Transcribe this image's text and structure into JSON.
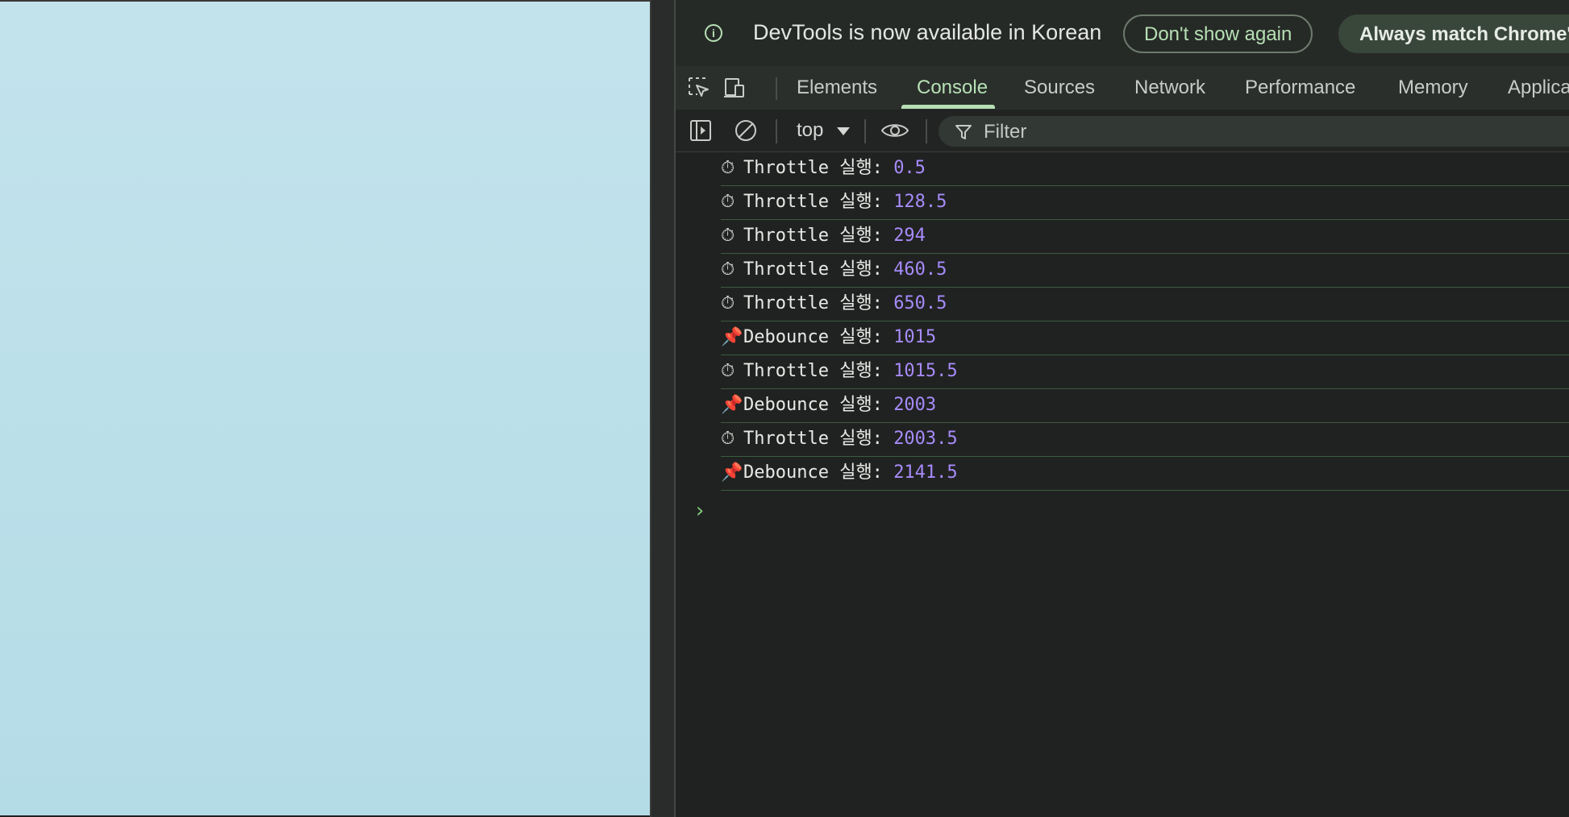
{
  "infobar": {
    "message": "DevTools is now available in Korean",
    "dont_show_label": "Don't show again",
    "always_match_label": "Always match Chrome's language"
  },
  "tabs": [
    {
      "label": "Elements",
      "active": false
    },
    {
      "label": "Console",
      "active": true
    },
    {
      "label": "Sources",
      "active": false
    },
    {
      "label": "Network",
      "active": false
    },
    {
      "label": "Performance",
      "active": false
    },
    {
      "label": "Memory",
      "active": false
    },
    {
      "label": "Application",
      "active": false
    }
  ],
  "toolbar": {
    "context": "top",
    "filter_placeholder": "Filter"
  },
  "console": {
    "logs": [
      {
        "icon": "stopwatch-icon",
        "label": "Throttle 실행:",
        "value": "0.5"
      },
      {
        "icon": "stopwatch-icon",
        "label": "Throttle 실행:",
        "value": "128.5"
      },
      {
        "icon": "stopwatch-icon",
        "label": "Throttle 실행:",
        "value": "294"
      },
      {
        "icon": "stopwatch-icon",
        "label": "Throttle 실행:",
        "value": "460.5"
      },
      {
        "icon": "stopwatch-icon",
        "label": "Throttle 실행:",
        "value": "650.5"
      },
      {
        "icon": "pushpin-icon",
        "label": "Debounce 실행:",
        "value": "1015"
      },
      {
        "icon": "stopwatch-icon",
        "label": "Throttle 실행:",
        "value": "1015.5"
      },
      {
        "icon": "pushpin-icon",
        "label": "Debounce 실행:",
        "value": "2003"
      },
      {
        "icon": "stopwatch-icon",
        "label": "Throttle 실행:",
        "value": "2003.5"
      },
      {
        "icon": "pushpin-icon",
        "label": "Debounce 실행:",
        "value": "2141.5"
      }
    ],
    "prompt": "›"
  },
  "colors": {
    "accent": "#b6e0b4",
    "number": "#a78bfa",
    "viewport": "#bfe1ea"
  }
}
